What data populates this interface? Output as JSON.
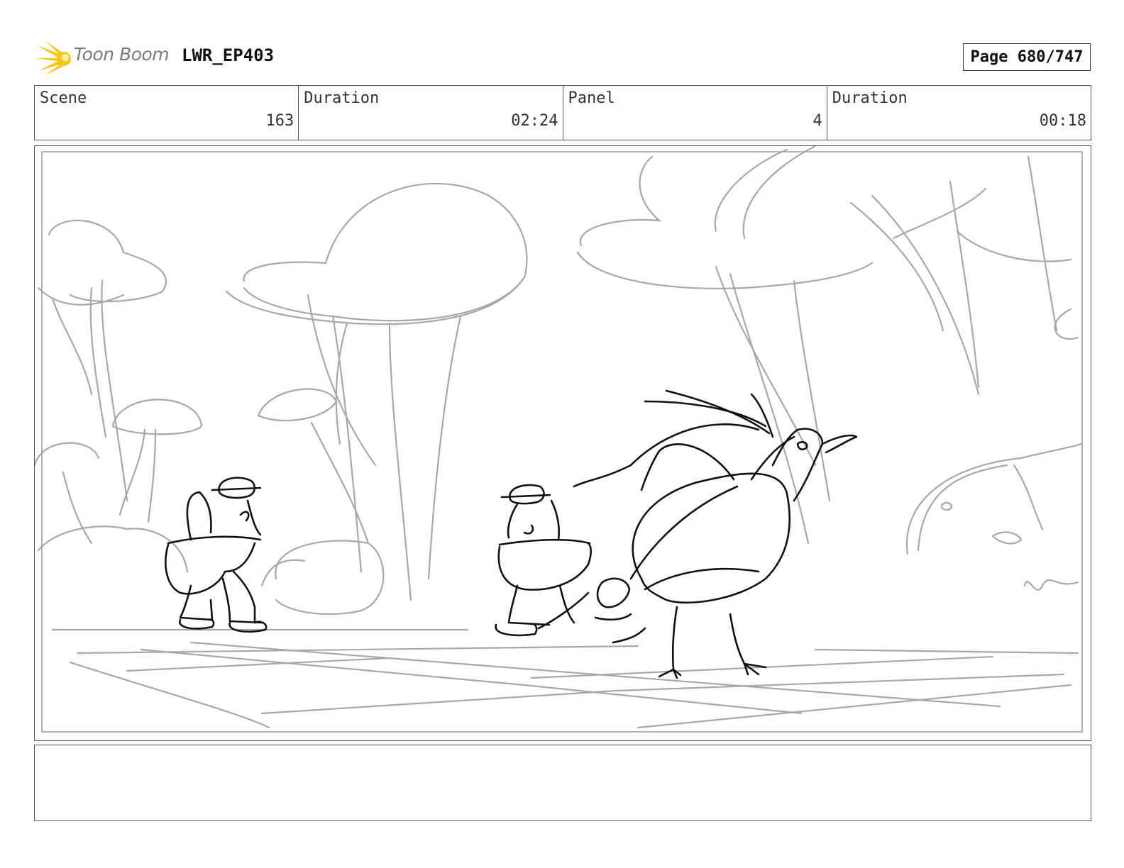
{
  "header": {
    "logo_text": "Toon Boom",
    "project": "LWR_EP403",
    "page": "Page 680/747"
  },
  "info": [
    {
      "label": "Scene",
      "value": "163"
    },
    {
      "label": "Duration",
      "value": "02:24"
    },
    {
      "label": "Panel",
      "value": "4"
    },
    {
      "label": "Duration",
      "value": "00:18"
    }
  ],
  "panel": {
    "description": "",
    "icons": [
      "toon-boom-logo-icon"
    ]
  },
  "notes": {
    "text": ""
  },
  "colors": {
    "background_sketch": "#a8a8a8",
    "character_sketch": "#111111",
    "logo_yellow": "#f5c518"
  }
}
